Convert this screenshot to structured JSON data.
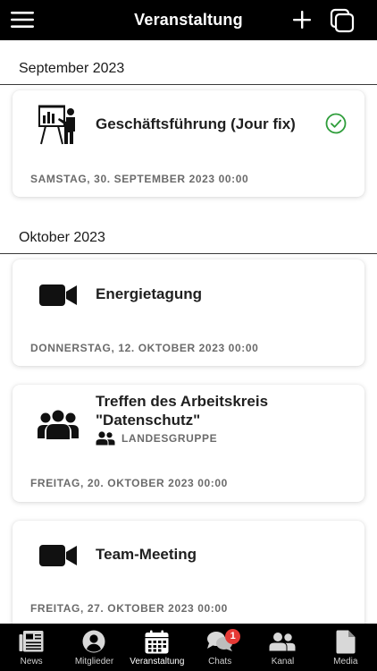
{
  "header": {
    "title": "Veranstaltung"
  },
  "months": [
    {
      "label": "September 2023",
      "events": [
        {
          "title": "Geschäftsführung (Jour fix)",
          "date": "SAMSTAG, 30. SEPTEMBER 2023 00:00",
          "icon": "presentation-icon",
          "status_icon": "check-circle-icon"
        }
      ]
    },
    {
      "label": "Oktober 2023",
      "events": [
        {
          "title": "Energietagung",
          "date": "DONNERSTAG, 12. OKTOBER 2023 00:00",
          "icon": "video-camera-icon"
        },
        {
          "title": "Treffen des Arbeitskreis \"Datenschutz\"",
          "group": "LANDESGRUPPE",
          "date": "FREITAG, 20. OKTOBER 2023 00:00",
          "icon": "group-icon"
        },
        {
          "title": "Team-Meeting",
          "date": "FREITAG, 27. OKTOBER 2023 00:00",
          "icon": "video-camera-icon"
        }
      ]
    }
  ],
  "tabs": [
    {
      "label": "News",
      "icon": "newspaper-icon"
    },
    {
      "label": "Mitglieder",
      "icon": "user-circle-icon"
    },
    {
      "label": "Veranstaltung",
      "icon": "calendar-icon",
      "active": true
    },
    {
      "label": "Chats",
      "icon": "chat-bubbles-icon",
      "badge": "1"
    },
    {
      "label": "Kanal",
      "icon": "people-icon"
    },
    {
      "label": "Media",
      "icon": "document-icon"
    }
  ],
  "colors": {
    "bar_background": "#000000",
    "accent_check": "#2e9d3a",
    "badge": "#e53935",
    "date_text": "#6b6b6b"
  }
}
